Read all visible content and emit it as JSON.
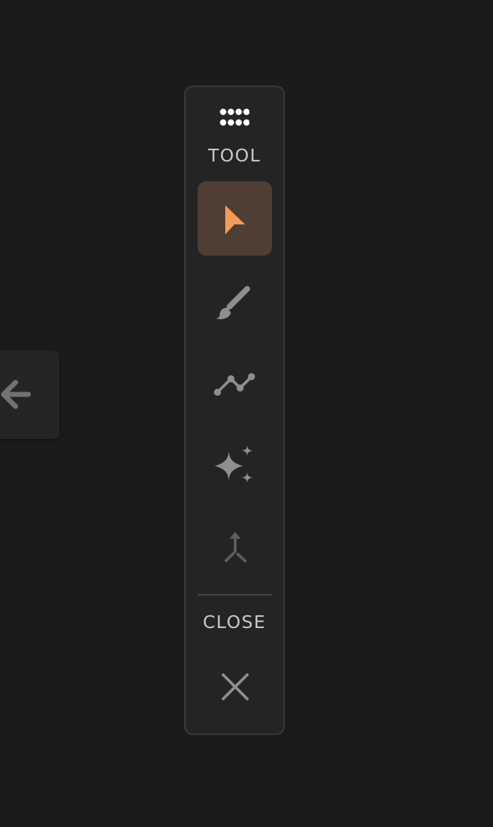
{
  "toolbar": {
    "tool_label": "TOOL",
    "close_label": "CLOSE",
    "tools": [
      {
        "name": "select",
        "icon": "pointer-arrow-icon",
        "active": true
      },
      {
        "name": "brush",
        "icon": "paintbrush-icon",
        "active": false
      },
      {
        "name": "polyline",
        "icon": "polyline-icon",
        "active": false
      },
      {
        "name": "magic",
        "icon": "sparkles-icon",
        "active": false
      },
      {
        "name": "merge",
        "icon": "merge-arrow-icon",
        "active": false,
        "disabled": true
      }
    ]
  },
  "side_tab": {
    "icon": "arrow-left-icon"
  },
  "colors": {
    "background": "#1b1b1b",
    "panel": "#242424",
    "panel_border": "#3a3a3a",
    "active_tool_bg": "#4e3e33",
    "accent": "#f39a5c",
    "icon": "#8e8e8e",
    "icon_disabled": "#5e5e5e",
    "label": "#c9c9c9"
  }
}
